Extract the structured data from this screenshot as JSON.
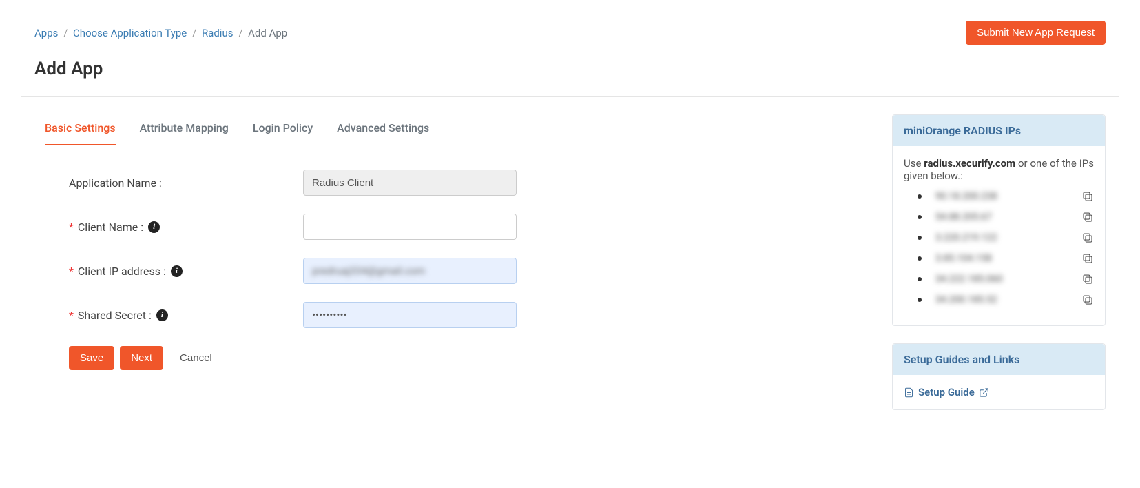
{
  "breadcrumb": {
    "items": [
      "Apps",
      "Choose Application Type",
      "Radius",
      "Add App"
    ]
  },
  "header": {
    "submit_btn": "Submit New App Request",
    "page_title": "Add App"
  },
  "tabs": [
    {
      "label": "Basic Settings",
      "active": true
    },
    {
      "label": "Attribute Mapping",
      "active": false
    },
    {
      "label": "Login Policy",
      "active": false
    },
    {
      "label": "Advanced Settings",
      "active": false
    }
  ],
  "form": {
    "app_name_label": "Application Name :",
    "app_name_value": "Radius Client",
    "client_name_label": "Client Name :",
    "client_name_value": "",
    "client_ip_label": "Client IP address :",
    "client_ip_value": "predruaj334@gmail.com",
    "shared_secret_label": "Shared Secret :",
    "shared_secret_value": "••••••••••",
    "save_btn": "Save",
    "next_btn": "Next",
    "cancel_btn": "Cancel"
  },
  "sidebar": {
    "ips_card": {
      "title": "miniOrange RADIUS IPs",
      "intro_prefix": "Use ",
      "host": "radius.xecurify.com",
      "intro_suffix": " or one of the IPs given below.:",
      "ips": [
        "90.18.200.238",
        "54.88.205.67",
        "3.220.219.122",
        "3.85.104.158",
        "34.222.185.060",
        "34.200.185.52"
      ]
    },
    "guides_card": {
      "title": "Setup Guides and Links",
      "link_label": "Setup Guide"
    }
  }
}
